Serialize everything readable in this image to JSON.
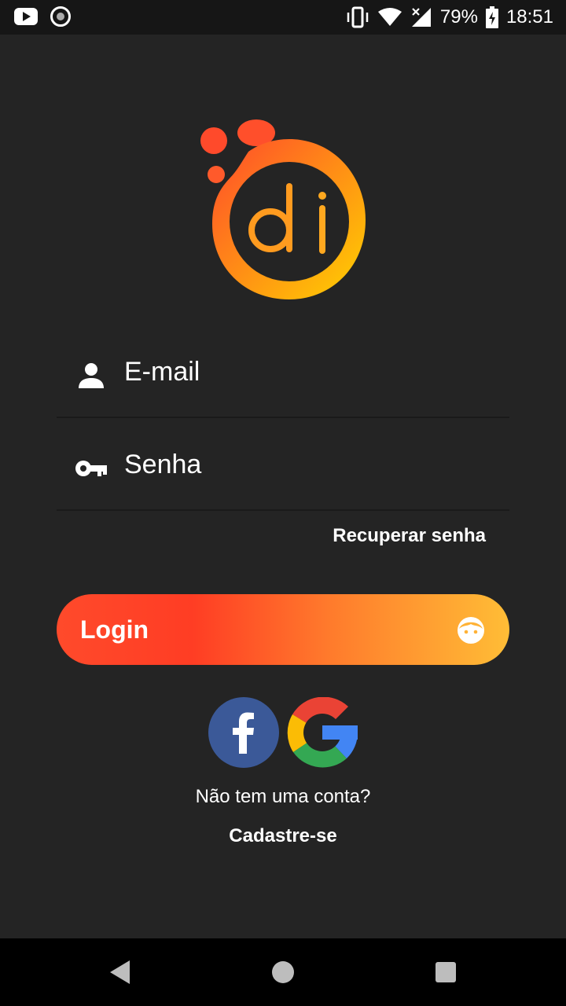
{
  "status_bar": {
    "battery": "79%",
    "time": "18:51",
    "icons": [
      "youtube-icon",
      "record-icon",
      "vibrate-icon",
      "wifi-icon",
      "signal-icon",
      "battery-charging-icon"
    ]
  },
  "logo": {
    "text": "di",
    "colors": {
      "start": "#ff4a2b",
      "end": "#ffd200"
    }
  },
  "form": {
    "email_placeholder": "E-mail",
    "password_placeholder": "Senha",
    "recover_link": "Recuperar senha"
  },
  "login_button": {
    "label": "Login",
    "icon": "face-icon"
  },
  "social": {
    "facebook": "facebook-icon",
    "google": "google-icon"
  },
  "footer": {
    "no_account": "Não tem uma conta?",
    "signup": "Cadastre-se"
  },
  "nav": {
    "icons": [
      "back-icon",
      "home-icon",
      "recents-icon"
    ]
  },
  "colors": {
    "background": "#242424",
    "accent_start": "#ff3d24",
    "accent_end": "#ffbd36",
    "facebook": "#3b5998"
  }
}
